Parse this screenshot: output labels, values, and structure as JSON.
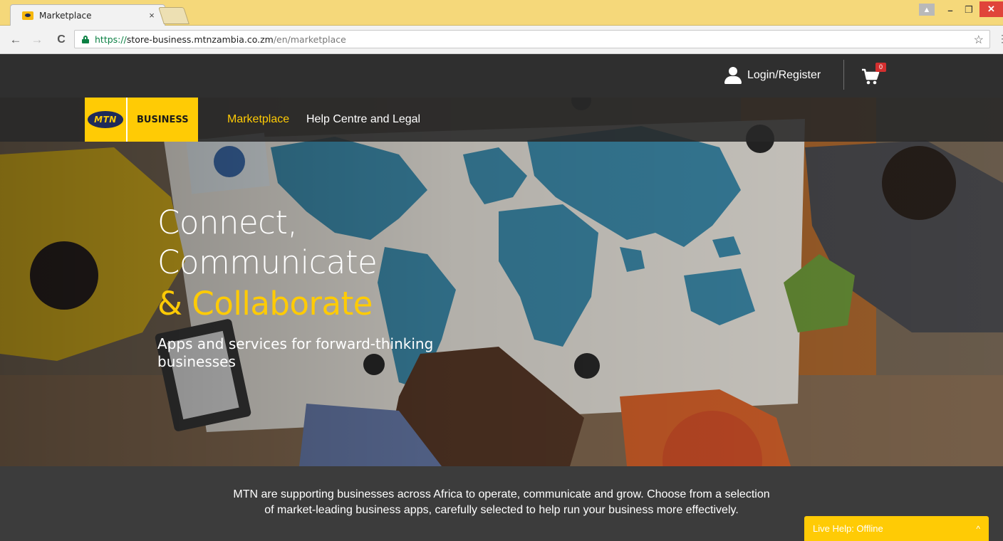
{
  "browser": {
    "tab_title": "Marketplace",
    "tab_close": "×",
    "url_scheme": "https://",
    "url_host": "store-business.mtnzambia.co.zm",
    "url_path": "/en/marketplace",
    "back_icon": "←",
    "forward_icon": "→",
    "reload_icon": "C",
    "star_icon": "☆",
    "menu_icon": "⋮",
    "min_icon": "–",
    "max_icon": "❐",
    "close_icon": "✕",
    "user_icon": "▲"
  },
  "header": {
    "login_label": "Login/Register",
    "cart_count": "0"
  },
  "nav": {
    "logo_mark": "MTN",
    "logo_word": "BUSINESS",
    "links": [
      "Marketplace",
      "Help Centre and Legal"
    ],
    "active_link": "Marketplace"
  },
  "hero": {
    "line1": "Connect,",
    "line2": "Communicate",
    "line3": "& Collaborate",
    "subtitle": "Apps and services for forward-thinking businesses"
  },
  "intro": {
    "text": "MTN are supporting businesses across Africa to operate, communicate and grow. Choose from a selection of market-leading business apps, carefully selected to help run your business more effectively."
  },
  "live_help": {
    "label": "Live Help: Offline",
    "chevron": "^"
  },
  "colors": {
    "brand_yellow": "#ffcb05",
    "brand_navy": "#1e2a5a",
    "header_dark": "#2f2f2f",
    "map_blue": "#3f8fb0",
    "tab_bar": "#f5d87a"
  }
}
